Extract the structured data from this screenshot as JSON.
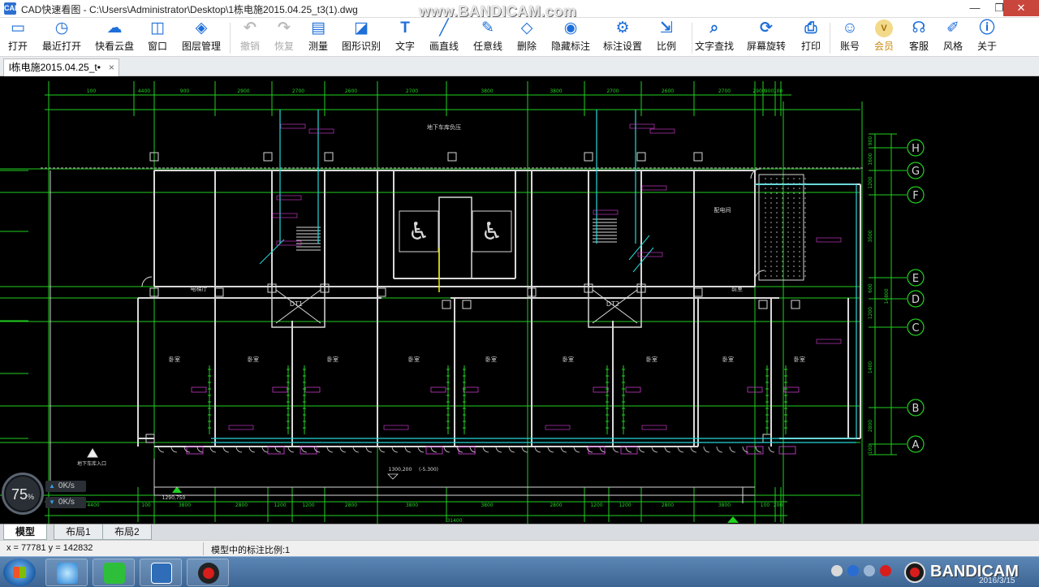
{
  "window": {
    "title": "CAD快速看图 - C:\\Users\\Administrator\\Desktop\\1栋电施2015.04.25_t3(1).dwg",
    "app_icon_text": "CAD",
    "watermark": "www.BANDICAM.com"
  },
  "toolbar": {
    "items": [
      {
        "label": "打开",
        "icon": "open-folder-icon"
      },
      {
        "label": "最近打开",
        "icon": "recent-clock-icon"
      },
      {
        "label": "快看云盘",
        "icon": "cloud-icon"
      },
      {
        "label": "窗口",
        "icon": "window-icon"
      },
      {
        "label": "图层管理",
        "icon": "layers-icon"
      },
      {
        "label": "撤销",
        "icon": "undo-icon"
      },
      {
        "label": "恢复",
        "icon": "redo-icon"
      },
      {
        "label": "测量",
        "icon": "measure-icon"
      },
      {
        "label": "图形识别",
        "icon": "shape-recognize-icon"
      },
      {
        "label": "文字",
        "icon": "text-icon"
      },
      {
        "label": "画直线",
        "icon": "line-icon"
      },
      {
        "label": "任意线",
        "icon": "pen-icon"
      },
      {
        "label": "删除",
        "icon": "eraser-icon"
      },
      {
        "label": "隐藏标注",
        "icon": "eye-icon"
      },
      {
        "label": "标注设置",
        "icon": "annotation-settings-icon"
      },
      {
        "label": "比例",
        "icon": "scale-icon"
      },
      {
        "label": "文字查找",
        "icon": "text-search-icon"
      },
      {
        "label": "屏幕旋转",
        "icon": "rotate-icon"
      },
      {
        "label": "打印",
        "icon": "printer-icon"
      },
      {
        "label": "账号",
        "icon": "account-icon"
      },
      {
        "label": "会员",
        "icon": "vip-icon"
      },
      {
        "label": "客服",
        "icon": "headset-icon"
      },
      {
        "label": "风格",
        "icon": "style-icon"
      },
      {
        "label": "关于",
        "icon": "info-icon"
      }
    ],
    "accent_color": "#1e6fd9"
  },
  "document_tab": {
    "label": "l栋电施2015.04.25_t•",
    "close": "×"
  },
  "drawing": {
    "top_dimensions": [
      "100",
      "4400",
      "900",
      "2900",
      "2700",
      "2600",
      "2700",
      "3800",
      "3800",
      "2700",
      "2600",
      "2700",
      "2900",
      "900",
      "100",
      "200"
    ],
    "bottom_dimensions": [
      "4400",
      "100",
      "3800",
      "2800",
      "1200",
      "1200",
      "2800",
      "3800",
      "3800",
      "2800",
      "1200",
      "1200",
      "2800",
      "3800",
      "100",
      "200"
    ],
    "bottom_total": "31400",
    "axis_labels": [
      "H",
      "G",
      "F",
      "E",
      "D",
      "C",
      "B",
      "A"
    ],
    "right_dimensions": [
      "900",
      "1600",
      "1200",
      "3500",
      "600",
      "1200",
      "1400",
      "2800",
      "100"
    ],
    "right_total": "14800",
    "room_labels": [
      "卧室",
      "卧室",
      "卧室",
      "卧室",
      "卧室",
      "卧室",
      "卧室",
      "卧室",
      "卧室",
      "电梯厅",
      "配电间",
      "前室"
    ],
    "header_label": "地下车库负压",
    "stair_labels": [
      "DT1",
      "DT2"
    ],
    "elevation_note": "1300,200",
    "elevation_note2": "(-5.300)",
    "elevation_bottom": "1290,750",
    "entry_label": "地下车库入口",
    "line_colors": {
      "dimension": "#21d021",
      "wall": "#d8d8d8",
      "annotation": "#e040e0",
      "axis": "#21d021",
      "pipe": "#27d7d7",
      "highlight": "#e7e700"
    }
  },
  "speed_widget": {
    "percent": "75",
    "percent_unit": "%",
    "rates": [
      "0K/s",
      "0K/s"
    ]
  },
  "layout_tabs": [
    "模型",
    "布局1",
    "布局2"
  ],
  "status": {
    "coords": "x = 77781  y = 142832",
    "scale": "模型中的标注比例:1"
  },
  "taskbar": {
    "items": [
      "ie-browser",
      "iqiyi",
      "cad-viewer",
      "bandicam-record"
    ],
    "bandicam_text": "BANDICAM",
    "date": "2016/3/15"
  }
}
